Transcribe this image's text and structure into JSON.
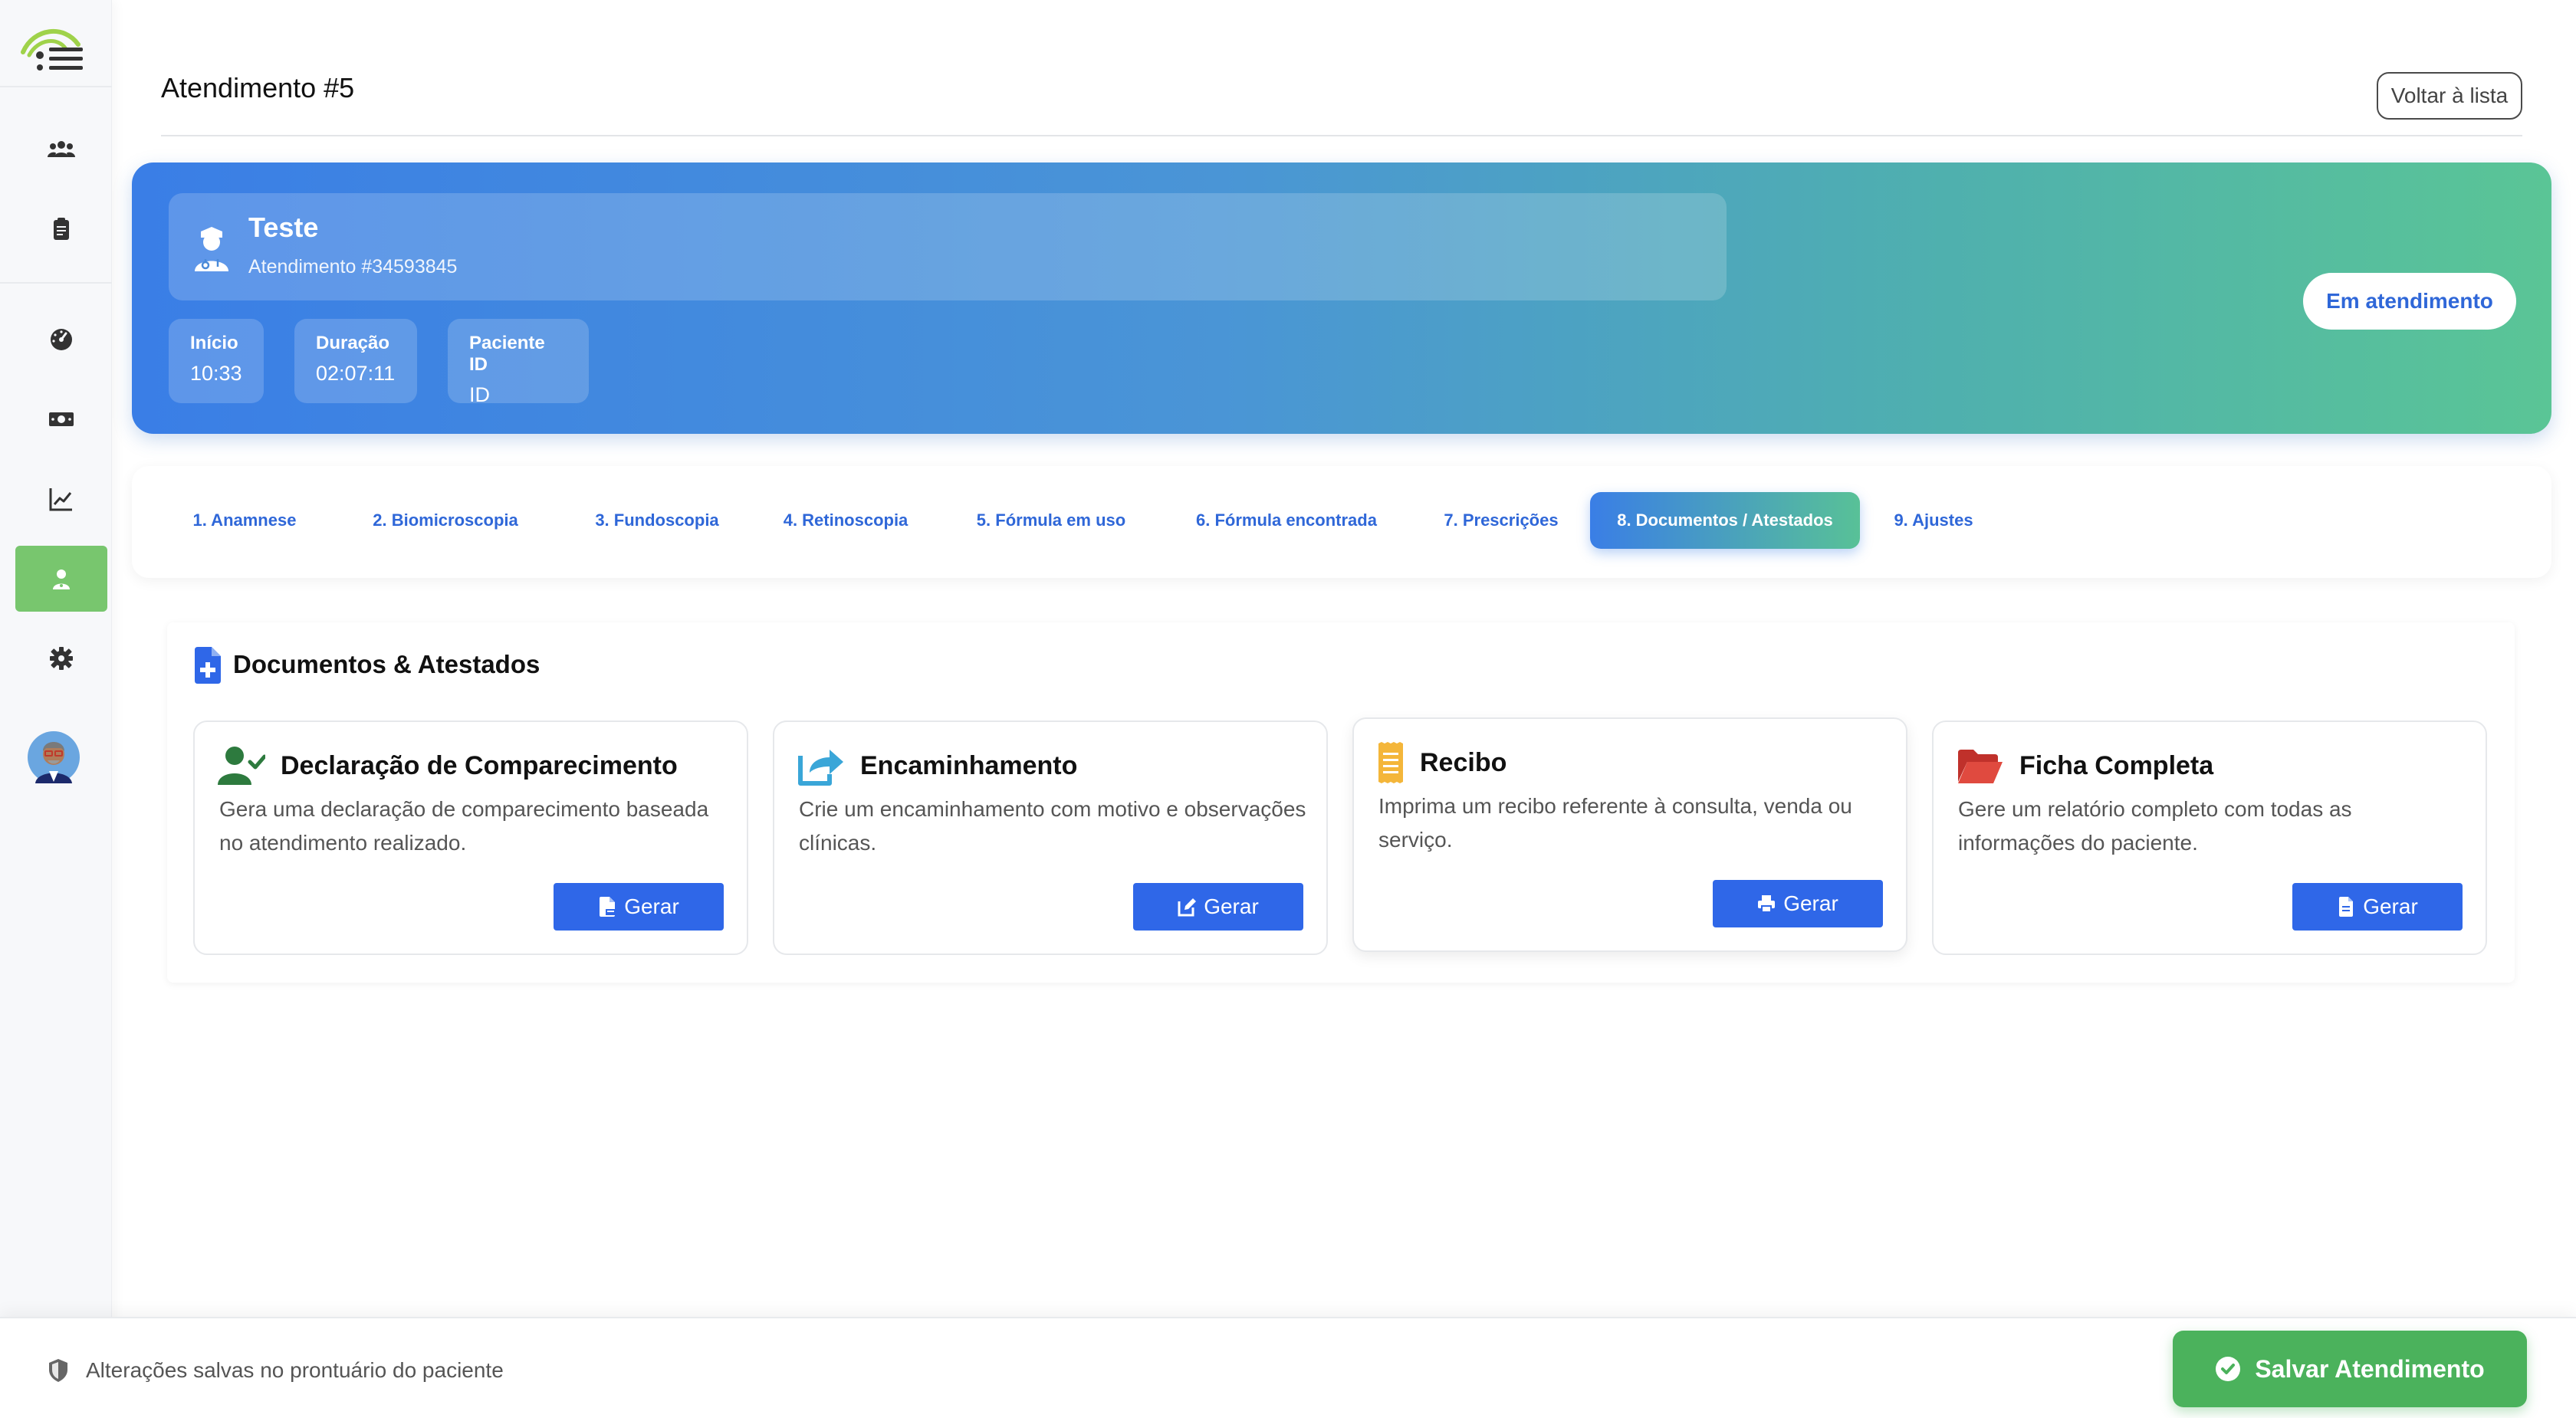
{
  "header": {
    "title": "Atendimento #5",
    "back_label": "Voltar à lista"
  },
  "patient": {
    "name": "Teste",
    "subtitle": "Atendimento #34593845",
    "stats": [
      {
        "label": "Início",
        "value": "10:33"
      },
      {
        "label": "Duração",
        "value": "02:07:11"
      },
      {
        "label": "Paciente ID",
        "value": "ID"
      }
    ],
    "status": "Em atendimento"
  },
  "tabs": [
    {
      "label": "1. Anamnese",
      "active": false
    },
    {
      "label": "2. Biomicroscopia",
      "active": false
    },
    {
      "label": "3. Fundoscopia",
      "active": false
    },
    {
      "label": "4. Retinoscopia",
      "active": false
    },
    {
      "label": "5. Fórmula em uso",
      "active": false
    },
    {
      "label": "6. Fórmula encontrada",
      "active": false
    },
    {
      "label": "7. Prescrições",
      "active": false
    },
    {
      "label": "8. Documentos / Atestados",
      "active": true
    },
    {
      "label": "9. Ajustes",
      "active": false
    }
  ],
  "documents": {
    "title": "Documentos & Atestados",
    "cards": [
      {
        "title": "Declaração de Comparecimento",
        "description": "Gera uma declaração de comparecimento baseada no atendimento realizado.",
        "button": "Gerar",
        "icon": "user-check-icon",
        "button_icon": "file-pdf-icon"
      },
      {
        "title": "Encaminhamento",
        "description": "Crie um encaminhamento com motivo e observações clínicas.",
        "button": "Gerar",
        "icon": "share-square-icon",
        "button_icon": "edit-icon"
      },
      {
        "title": "Recibo",
        "description": "Imprima um recibo referente à consulta, venda ou serviço.",
        "button": "Gerar",
        "icon": "receipt-icon",
        "button_icon": "print-icon"
      },
      {
        "title": "Ficha Completa",
        "description": "Gere um relatório completo com todas as informações do paciente.",
        "button": "Gerar",
        "icon": "folder-open-icon",
        "button_icon": "file-icon"
      }
    ]
  },
  "footer": {
    "note": "Alterações salvas no prontuário do paciente",
    "save_label": "Salvar Atendimento"
  },
  "colors": {
    "primary": "#2f67e8",
    "accent_green": "#4bb25c",
    "sidebar_active": "#78c66e"
  }
}
